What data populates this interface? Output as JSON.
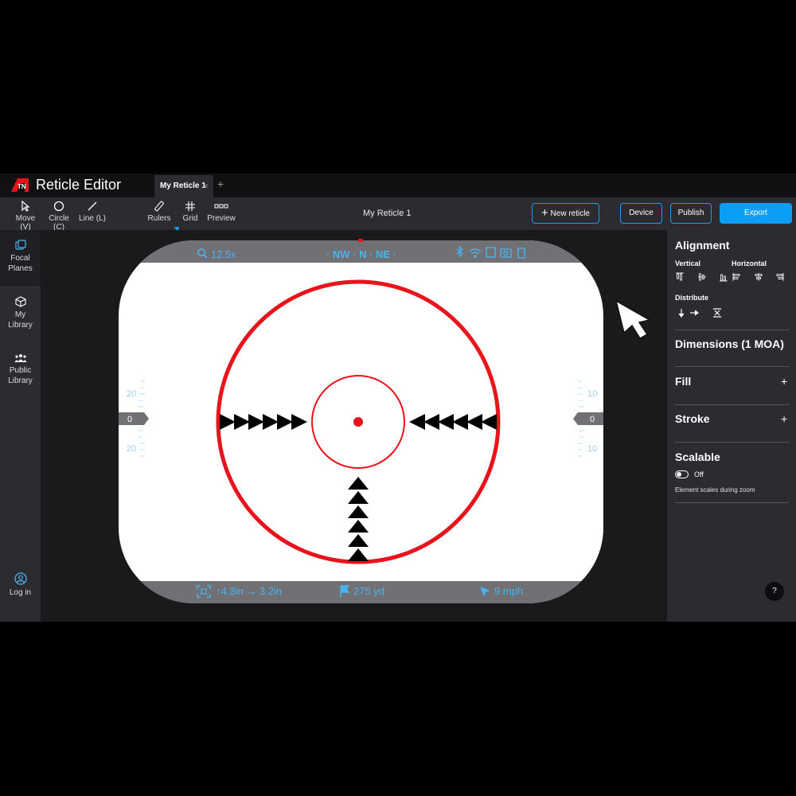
{
  "app": {
    "title": "Reticle Editor"
  },
  "tabs": [
    {
      "label": "My Reticle 1",
      "close": "×"
    }
  ],
  "tab_add": "+",
  "toolbar": {
    "tools": [
      {
        "label": "Move (V)",
        "icon": "pointer-icon"
      },
      {
        "label": "Circle (C)",
        "icon": "circle-icon"
      },
      {
        "label": "Line (L)",
        "icon": "line-icon"
      },
      {
        "label": "Rulers",
        "icon": "ruler-icon"
      },
      {
        "label": "Grid",
        "icon": "grid-icon"
      },
      {
        "label": "Preview",
        "icon": "preview-icon"
      }
    ],
    "document_title": "My Reticle 1",
    "new_reticle": "New reticle",
    "new_reticle_icon": "+",
    "device": "Device",
    "publish": "Publish",
    "export": "Export"
  },
  "sidebar": {
    "items": [
      {
        "label_line1": "Focal",
        "label_line2": "Planes",
        "icon": "layers-icon",
        "active": true
      },
      {
        "label_line1": "My",
        "label_line2": "Library",
        "icon": "box-icon"
      },
      {
        "label_line1": "Public",
        "label_line2": "Library",
        "icon": "people-icon"
      }
    ],
    "login": "Log in"
  },
  "scope": {
    "zoom": "12.5x",
    "compass": "· NW · N · NE ·",
    "status_icons": [
      "bluetooth-icon",
      "wifi-icon",
      "film-icon",
      "camera-icon",
      "battery-icon"
    ],
    "left_scale": {
      "top": "20",
      "center": "0",
      "bottom": "20"
    },
    "right_scale": {
      "top": "10",
      "center": "0",
      "bottom": "10"
    },
    "offset": "↑4.3in → 3.2in",
    "distance": "275 yd",
    "wind": "9 mph",
    "colors": {
      "reticle": "#e8131b",
      "hud_text": "#4bb3ee",
      "hud_bar": "#707075",
      "background": "#ffffff"
    },
    "reticle": {
      "outer_circle": true,
      "inner_circle": true,
      "center_dot": true,
      "left_arrows": 6,
      "right_arrows": 6,
      "bottom_arrows": 6
    }
  },
  "panel": {
    "alignment": "Alignment",
    "vertical": "Vertical",
    "horizontal": "Horizontal",
    "distribute": "Distribute",
    "dimensions": "Dimensions (1 MOA)",
    "fill": "Fill",
    "stroke": "Stroke",
    "plus": "+",
    "scalable": "Scalable",
    "scalable_state": "Off",
    "scalable_desc": "Element scales during zoom"
  },
  "help": "?"
}
